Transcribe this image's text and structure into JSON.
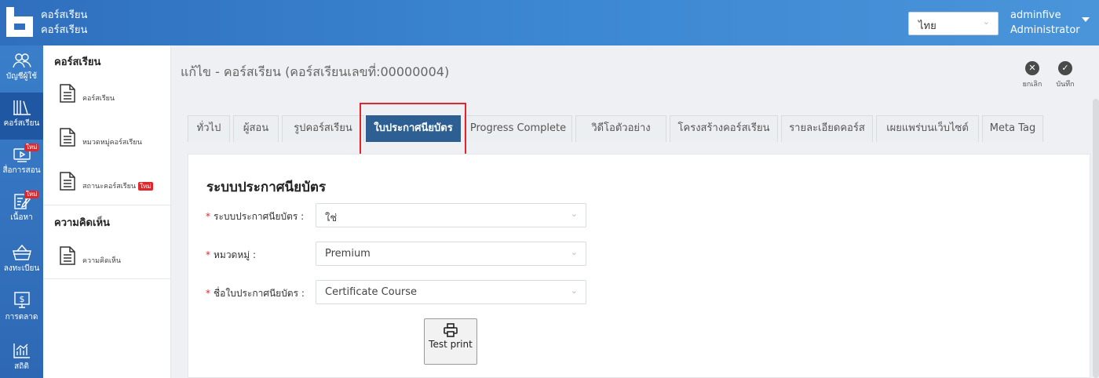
{
  "header": {
    "app_title_line1": "คอร์สเรียน",
    "app_title_line2": "คอร์สเรียน",
    "language": "ไทย",
    "user_name": "adminfive",
    "user_role": "Administrator"
  },
  "rail": {
    "items": [
      {
        "label": "บัญชีผู้ใช้",
        "icon": "users-icon"
      },
      {
        "label": "คอร์สเรียน",
        "icon": "library-icon"
      },
      {
        "label": "สื่อการสอน",
        "icon": "media-player-icon",
        "badge": "ใหม่"
      },
      {
        "label": "เนื้อหา",
        "icon": "content-edit-icon",
        "badge": "ใหม่"
      },
      {
        "label": "ลงทะเบียน",
        "icon": "basket-icon"
      },
      {
        "label": "การตลาด",
        "icon": "dollar-monitor-icon"
      },
      {
        "label": "สถิติ",
        "icon": "bar-chart-icon"
      }
    ]
  },
  "submenu": {
    "section1_title": "คอร์สเรียน",
    "section1_items": [
      {
        "label": "คอร์สเรียน"
      },
      {
        "label": "หมวดหมู่คอร์สเรียน"
      },
      {
        "label": "สถานะคอร์สเรียน",
        "badge": "ใหม่"
      }
    ],
    "section2_title": "ความคิดเห็น",
    "section2_items": [
      {
        "label": "ความคิดเห็น"
      }
    ]
  },
  "main": {
    "page_title": "แก้ไข - คอร์สเรียน (คอร์สเรียนเลขที่:00000004)",
    "cancel_label": "ยกเลิก",
    "save_label": "บันทึก",
    "tabs": [
      {
        "label": "ทั่วไป"
      },
      {
        "label": "ผู้สอน"
      },
      {
        "label": "รูปคอร์สเรียน"
      },
      {
        "label": "ใบประกาศนียบัตร",
        "active": true
      },
      {
        "label": "Progress Complete"
      },
      {
        "label": "วิดีโอตัวอย่าง"
      },
      {
        "label": "โครงสร้างคอร์สเรียน"
      },
      {
        "label": "รายละเอียดคอร์ส"
      },
      {
        "label": "เผยแพร่บนเว็บไซต์"
      },
      {
        "label": "Meta Tag"
      }
    ],
    "panel_title": "ระบบประกาศนียบัตร",
    "fields": [
      {
        "label": "ระบบประกาศนียบัตร :",
        "value": "ใช่"
      },
      {
        "label": "หมวดหมู่ :",
        "value": "Premium"
      },
      {
        "label": "ชื่อใบประกาศนียบัตร :",
        "value": "Certificate Course"
      }
    ],
    "required_mark": "*",
    "print_button_label": "Test print"
  },
  "colors": {
    "header_blue": "#3c87d2",
    "active_tab": "#2e5f93",
    "highlight_red": "#e0262b",
    "new_badge": "#e0262b"
  }
}
